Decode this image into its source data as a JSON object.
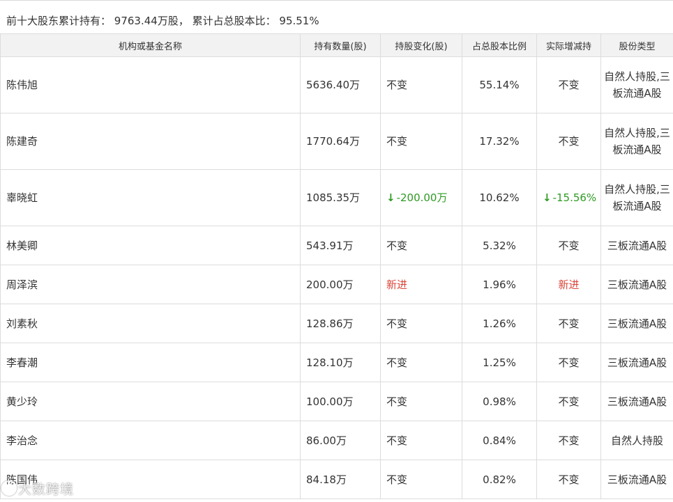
{
  "summary": {
    "label": "前十大股东累计持有：",
    "total": "9763.44万股，",
    "ratio_label": "累计占总股本比：",
    "ratio": "95.51%"
  },
  "table": {
    "headers": [
      "机构或基金名称",
      "持有数量(股)",
      "持股变化(股)",
      "占总股本比例",
      "实际增减持",
      "股份类型"
    ],
    "rows": [
      {
        "name": "陈伟旭",
        "qty": "5636.40万",
        "change": "不变",
        "change_dir": "none",
        "pct": "55.14%",
        "real": "不变",
        "real_dir": "none",
        "type": "自然人持股,三板流通A股"
      },
      {
        "name": "陈建奇",
        "qty": "1770.64万",
        "change": "不变",
        "change_dir": "none",
        "pct": "17.32%",
        "real": "不变",
        "real_dir": "none",
        "type": "自然人持股,三板流通A股"
      },
      {
        "name": "辜晓虹",
        "qty": "1085.35万",
        "change": "-200.00万",
        "change_dir": "down",
        "pct": "10.62%",
        "real": "-15.56%",
        "real_dir": "down",
        "type": "自然人持股,三板流通A股"
      },
      {
        "name": "林美卿",
        "qty": "543.91万",
        "change": "不变",
        "change_dir": "none",
        "pct": "5.32%",
        "real": "不变",
        "real_dir": "none",
        "type": "三板流通A股"
      },
      {
        "name": "周泽滨",
        "qty": "200.00万",
        "change": "新进",
        "change_dir": "new",
        "pct": "1.96%",
        "real": "新进",
        "real_dir": "new",
        "type": "三板流通A股"
      },
      {
        "name": "刘素秋",
        "qty": "128.86万",
        "change": "不变",
        "change_dir": "none",
        "pct": "1.26%",
        "real": "不变",
        "real_dir": "none",
        "type": "三板流通A股"
      },
      {
        "name": "李春潮",
        "qty": "128.10万",
        "change": "不变",
        "change_dir": "none",
        "pct": "1.25%",
        "real": "不变",
        "real_dir": "none",
        "type": "三板流通A股"
      },
      {
        "name": "黄少玲",
        "qty": "100.00万",
        "change": "不变",
        "change_dir": "none",
        "pct": "0.98%",
        "real": "不变",
        "real_dir": "none",
        "type": "三板流通A股"
      },
      {
        "name": "李治念",
        "qty": "86.00万",
        "change": "不变",
        "change_dir": "none",
        "pct": "0.84%",
        "real": "不变",
        "real_dir": "none",
        "type": "自然人持股"
      },
      {
        "name": "陈国伟",
        "qty": "84.18万",
        "change": "不变",
        "change_dir": "none",
        "pct": "0.82%",
        "real": "不变",
        "real_dir": "none",
        "type": "三板流通A股"
      }
    ]
  },
  "watermark": {
    "text": "大数跨境"
  },
  "colors": {
    "increase_new": "#d9473a",
    "decrease": "#2e9b23",
    "header_bg": "#f2f2f2",
    "border": "#dcdcdc"
  },
  "icons": {
    "decrease": "arrow-down-icon"
  }
}
